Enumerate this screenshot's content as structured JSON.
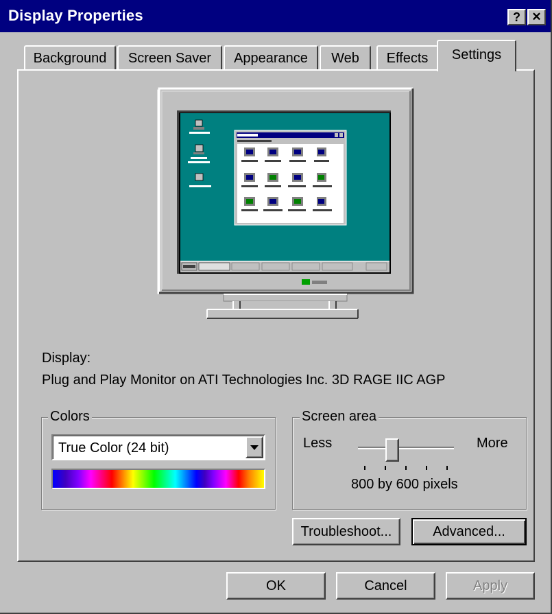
{
  "window": {
    "title": "Display Properties",
    "help_button": "?",
    "close_button": "✕"
  },
  "tabs": [
    {
      "label": "Background"
    },
    {
      "label": "Screen Saver"
    },
    {
      "label": "Appearance"
    },
    {
      "label": "Web"
    },
    {
      "label": "Effects"
    },
    {
      "label": "Settings",
      "active": true
    }
  ],
  "display": {
    "heading": "Display:",
    "device": "Plug and Play Monitor on ATI Technologies Inc. 3D RAGE IIC AGP"
  },
  "colors": {
    "group_label": "Colors",
    "selected": "True Color (24 bit)"
  },
  "screen_area": {
    "group_label": "Screen area",
    "less_label": "Less",
    "more_label": "More",
    "resolution": "800 by 600 pixels",
    "slider_level": 0.33
  },
  "buttons": {
    "troubleshoot": "Troubleshoot...",
    "advanced": "Advanced...",
    "ok": "OK",
    "cancel": "Cancel",
    "apply": "Apply"
  },
  "theme": {
    "titlebar": "#000080",
    "face": "#c0c0c0",
    "desktop": "#008080"
  }
}
